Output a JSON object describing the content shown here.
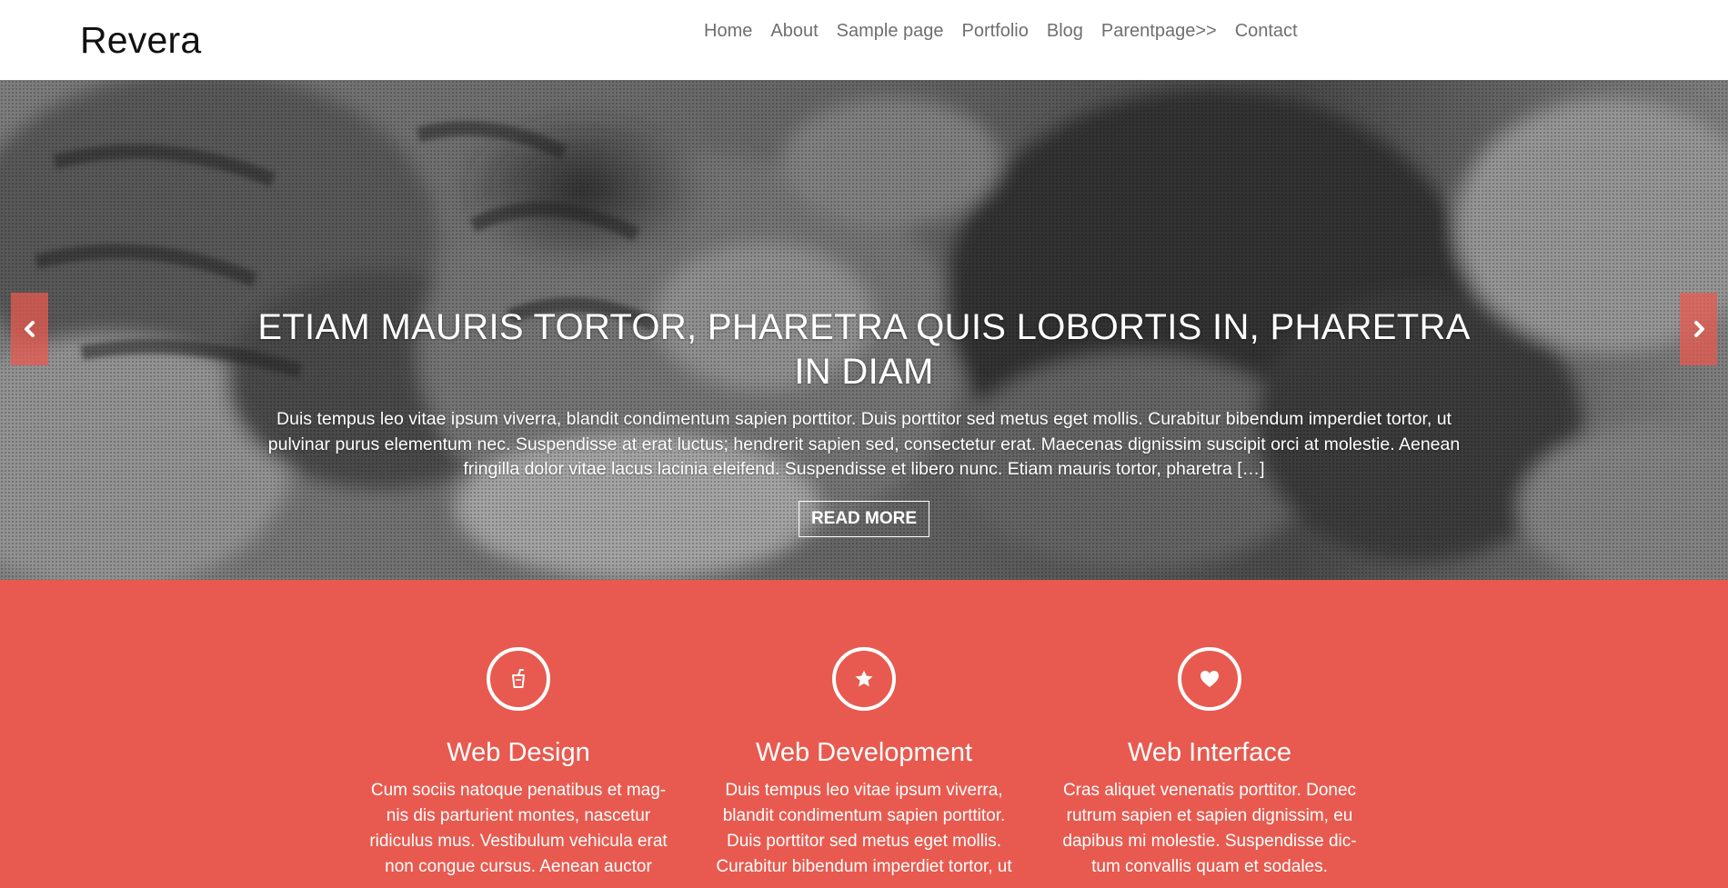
{
  "site": {
    "title": "Revera"
  },
  "nav": {
    "items": [
      {
        "label": "Home"
      },
      {
        "label": "About"
      },
      {
        "label": "Sample page"
      },
      {
        "label": "Portfolio"
      },
      {
        "label": "Blog"
      },
      {
        "label": "Parentpage>>"
      },
      {
        "label": "Contact"
      }
    ]
  },
  "slider": {
    "title": "ETIAM MAURIS TORTOR, PHARETRA QUIS LOBORTIS IN, PHARETRA IN DIAM",
    "excerpt": "Duis tempus leo vitae ipsum viverra, blandit condimentum sapien porttitor. Duis porttitor sed metus eget mollis. Curabitur bibendum imperdiet tortor, ut pulvinar purus elementum nec. Suspendisse at erat luctus; hendrerit sapien sed, consectetur erat. Maecenas dignissim suscipit orci at molestie. Aenean fringilla dolor vitae lacus lacinia eleifend. Suspendisse et libero nunc. Etiam mauris tortor, pharetra […]",
    "button_label": "READ MORE",
    "prev_icon": "chevron-left-icon",
    "next_icon": "chevron-right-icon",
    "photo": "grayscale photo of a sleeping cat and dog"
  },
  "services": {
    "items": [
      {
        "icon": "cup-icon",
        "title": "Web Design",
        "text": "Cum sociis natoque penatibus et mag-nis dis parturient montes, nascetur ridiculus mus. Vestibulum vehicula erat non congue cursus. Aenean auctor"
      },
      {
        "icon": "star-icon",
        "title": "Web Development",
        "text": "Duis tempus leo vitae ipsum viverra, blandit condimentum sapien porttitor. Duis porttitor sed metus eget mollis. Curabitur bibendum imperdiet tortor, ut"
      },
      {
        "icon": "heart-icon",
        "title": "Web Interface",
        "text": "Cras aliquet venenatis porttitor. Donec rutrum sapien et sapien dignissim, eu dapibus mi molestie. Suspendisse dic-tum convallis quam et sodales."
      }
    ]
  },
  "colors": {
    "accent": "#e85a4f",
    "nav_text": "#6f6f6f",
    "header_bg": "#ffffff"
  }
}
